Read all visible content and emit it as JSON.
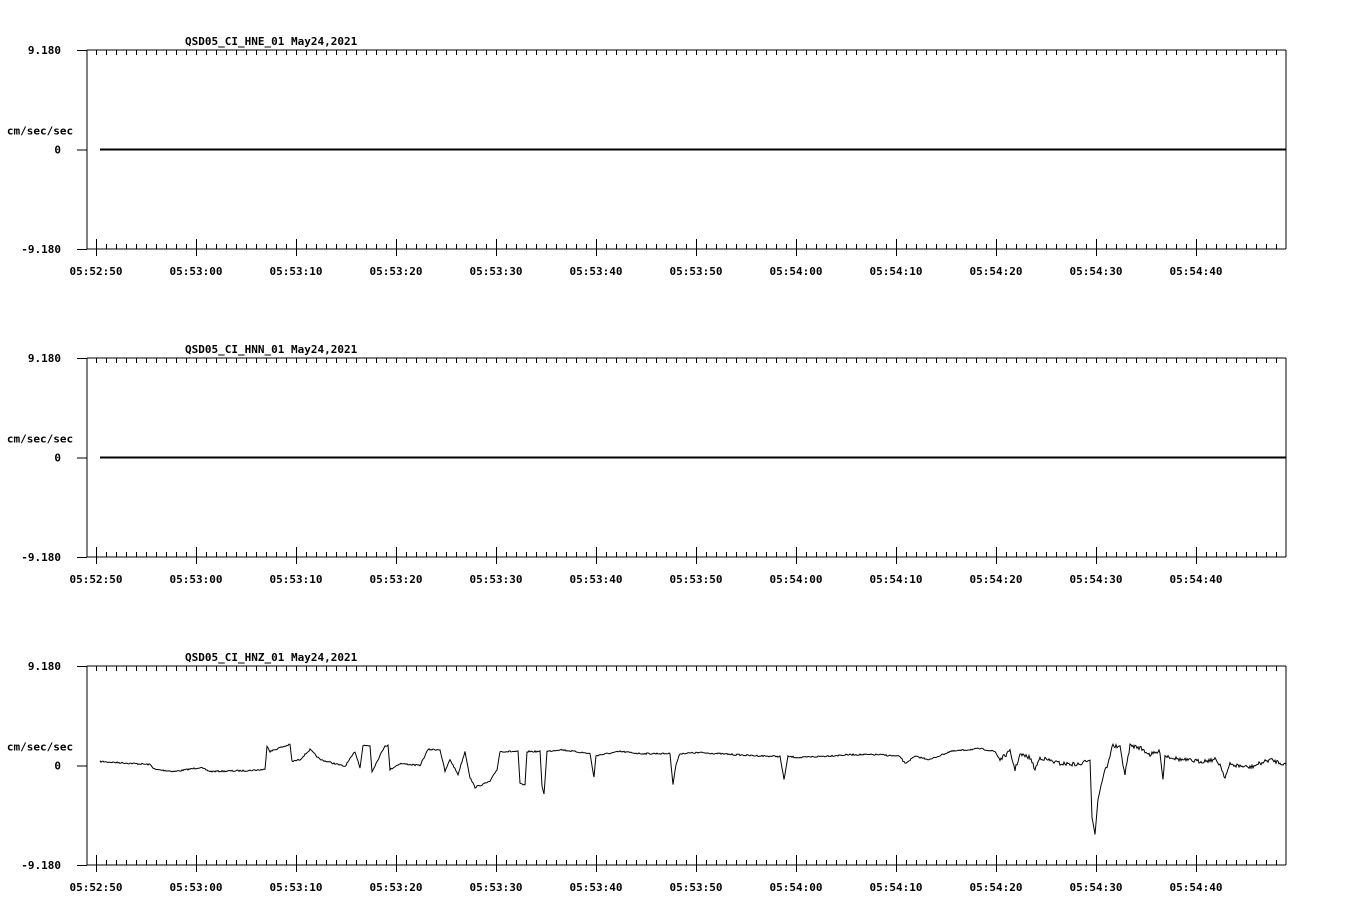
{
  "chart_data": [
    {
      "type": "line",
      "title": "QSD05_CI_HNE_01  May24,2021",
      "ylabel": "cm/sec/sec",
      "ylim": [
        -9.18,
        9.18
      ],
      "ytick_labels": [
        "9.180",
        "0",
        "-9.180"
      ],
      "xlim_seconds": [
        -0.9,
        118.0
      ],
      "x_tick_labels": [
        "05:52:50",
        "05:53:00",
        "05:53:10",
        "05:53:20",
        "05:53:30",
        "05:53:40",
        "05:53:50",
        "05:54:00",
        "05:54:10",
        "05:54:20",
        "05:54:30",
        "05:54:40"
      ],
      "series": [
        {
          "name": "HNE",
          "points": [
            [
              0.4,
              0
            ],
            [
              119,
              0
            ]
          ]
        }
      ]
    },
    {
      "type": "line",
      "title": "QSD05_CI_HNN_01  May24,2021",
      "ylabel": "cm/sec/sec",
      "ylim": [
        -9.18,
        9.18
      ],
      "ytick_labels": [
        "9.180",
        "0",
        "-9.180"
      ],
      "xlim_seconds": [
        -0.9,
        118.0
      ],
      "x_tick_labels": [
        "05:52:50",
        "05:53:00",
        "05:53:10",
        "05:53:20",
        "05:53:30",
        "05:53:40",
        "05:53:50",
        "05:54:00",
        "05:54:10",
        "05:54:20",
        "05:54:30",
        "05:54:40"
      ],
      "series": [
        {
          "name": "HNN",
          "points": [
            [
              0.4,
              0
            ],
            [
              119,
              0
            ]
          ]
        }
      ]
    },
    {
      "type": "line",
      "title": "QSD05_CI_HNZ_01  May24,2021",
      "ylabel": "cm/sec/sec",
      "ylim": [
        -9.18,
        9.18
      ],
      "ytick_labels": [
        "9.180",
        "0",
        "-9.180"
      ],
      "xlim_seconds": [
        -0.9,
        118.0
      ],
      "x_tick_labels": [
        "05:52:50",
        "05:53:00",
        "05:53:10",
        "05:53:20",
        "05:53:30",
        "05:53:40",
        "05:53:50",
        "05:54:00",
        "05:54:10",
        "05:54:20",
        "05:54:30",
        "05:54:40"
      ],
      "series": [
        {
          "name": "HNZ",
          "points": [
            [
              0.4,
              0.37
            ],
            [
              5.4,
              0.09
            ],
            [
              5.9,
              -0.37
            ],
            [
              7.9,
              -0.55
            ],
            [
              10.4,
              -0.18
            ],
            [
              11.4,
              -0.55
            ],
            [
              15.4,
              -0.46
            ],
            [
              16.9,
              -0.37
            ],
            [
              17.1,
              1.84
            ],
            [
              17.4,
              1.29
            ],
            [
              18.4,
              1.65
            ],
            [
              19.4,
              1.93
            ],
            [
              19.6,
              0.37
            ],
            [
              20.4,
              0.55
            ],
            [
              21.4,
              1.47
            ],
            [
              22.4,
              0.55
            ],
            [
              24.9,
              -0.09
            ],
            [
              25.9,
              1.29
            ],
            [
              26.4,
              -0.18
            ],
            [
              26.7,
              1.84
            ],
            [
              27.4,
              1.84
            ],
            [
              27.6,
              -0.55
            ],
            [
              28.9,
              1.84
            ],
            [
              29.2,
              1.84
            ],
            [
              29.4,
              -0.37
            ],
            [
              30.4,
              0.18
            ],
            [
              32.4,
              0
            ],
            [
              33.2,
              1.47
            ],
            [
              34.4,
              1.47
            ],
            [
              34.9,
              -0.55
            ],
            [
              35.4,
              0.55
            ],
            [
              36.2,
              -0.83
            ],
            [
              36.9,
              1.29
            ],
            [
              37.4,
              -1.1
            ],
            [
              37.9,
              -2.02
            ],
            [
              39.4,
              -1.47
            ],
            [
              40.1,
              -0.37
            ],
            [
              40.4,
              1.29
            ],
            [
              42.2,
              1.29
            ],
            [
              42.4,
              -1.65
            ],
            [
              42.9,
              -1.84
            ],
            [
              43.1,
              1.29
            ],
            [
              44.4,
              1.29
            ],
            [
              44.6,
              -1.84
            ],
            [
              44.8,
              -2.66
            ],
            [
              45.1,
              1.29
            ],
            [
              46.4,
              1.47
            ],
            [
              49.4,
              1.1
            ],
            [
              49.8,
              -1.1
            ],
            [
              50.0,
              0.92
            ],
            [
              52.4,
              1.29
            ],
            [
              54.4,
              1.1
            ],
            [
              57.4,
              1.1
            ],
            [
              57.7,
              -1.74
            ],
            [
              58.0,
              0.09
            ],
            [
              58.4,
              1.1
            ],
            [
              60.4,
              1.19
            ],
            [
              65.4,
              0.92
            ],
            [
              68.4,
              0.83
            ],
            [
              68.8,
              -1.29
            ],
            [
              69.2,
              0.83
            ],
            [
              70.4,
              0.73
            ],
            [
              75.4,
              1.0
            ],
            [
              78.4,
              1.0
            ],
            [
              80.4,
              0.83
            ],
            [
              80.9,
              0.18
            ],
            [
              81.9,
              0.83
            ],
            [
              83.4,
              0.55
            ],
            [
              85.4,
              1.29
            ],
            [
              88.4,
              1.56
            ],
            [
              89.9,
              1.29
            ],
            [
              90.4,
              0.55
            ],
            [
              91.4,
              1.29
            ],
            [
              91.9,
              -0.37
            ],
            [
              92.4,
              1.0
            ],
            [
              93.4,
              0.73
            ],
            [
              93.9,
              -0.37
            ],
            [
              94.4,
              0.73
            ],
            [
              96.4,
              0.18
            ],
            [
              98.4,
              0.09
            ],
            [
              99.4,
              0.55
            ],
            [
              99.6,
              -4.77
            ],
            [
              99.9,
              -6.33
            ],
            [
              100.2,
              -3.12
            ],
            [
              100.6,
              -1.47
            ],
            [
              100.9,
              -0.37
            ],
            [
              101.2,
              0.09
            ],
            [
              101.6,
              1.84
            ],
            [
              102.4,
              1.65
            ],
            [
              102.9,
              -0.83
            ],
            [
              103.4,
              1.84
            ],
            [
              104.4,
              1.65
            ],
            [
              105.4,
              1.0
            ],
            [
              106.4,
              1.29
            ],
            [
              106.7,
              -1.29
            ],
            [
              106.9,
              0.92
            ],
            [
              108.4,
              0.55
            ],
            [
              110.4,
              0.37
            ],
            [
              111.9,
              0.55
            ],
            [
              112.4,
              0.09
            ],
            [
              112.9,
              -1.1
            ],
            [
              113.4,
              0.09
            ],
            [
              115.4,
              -0.18
            ],
            [
              117.4,
              0.55
            ],
            [
              119.0,
              0.09
            ]
          ]
        }
      ]
    }
  ]
}
